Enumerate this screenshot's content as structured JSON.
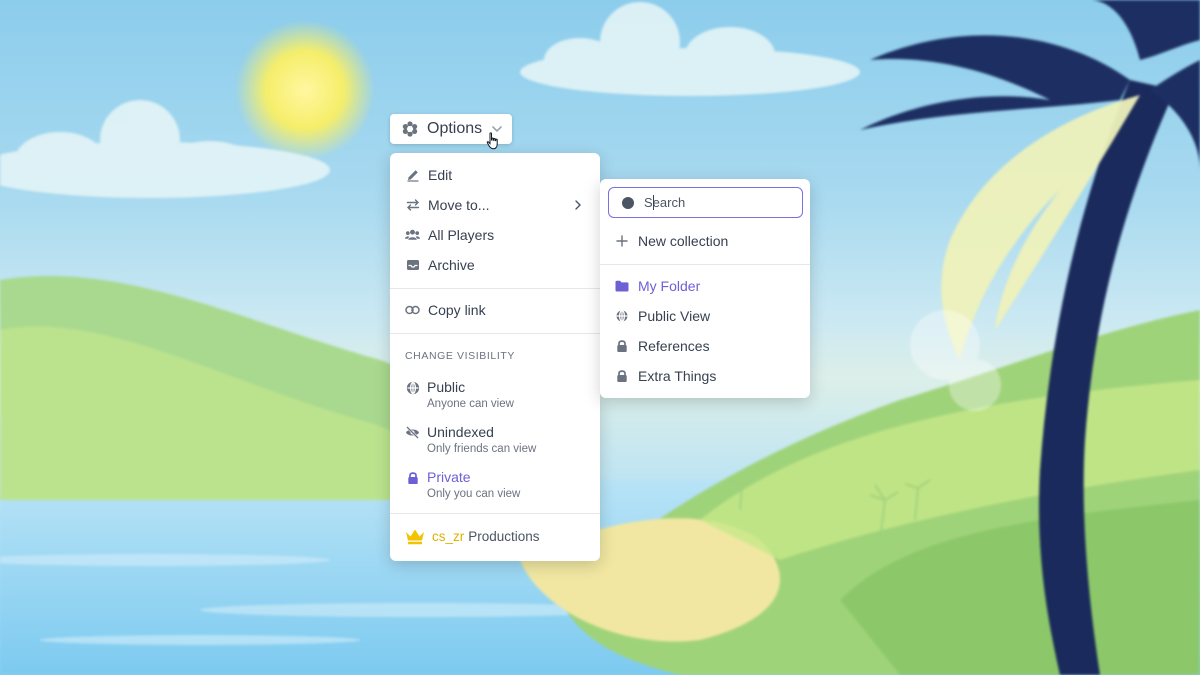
{
  "options_button": {
    "label": "Options"
  },
  "menu": {
    "items": [
      {
        "label": "Edit",
        "icon": "pencil-icon"
      },
      {
        "label": "Move to...",
        "icon": "arrows-exchange-icon",
        "has_submenu": true
      },
      {
        "label": "All Players",
        "icon": "users-icon"
      },
      {
        "label": "Archive",
        "icon": "inbox-icon"
      }
    ],
    "copy_link": {
      "label": "Copy link",
      "icon": "link-icon"
    },
    "visibility": {
      "heading": "CHANGE VISIBILITY",
      "options": [
        {
          "label": "Public",
          "description": "Anyone can view",
          "icon": "globe-icon"
        },
        {
          "label": "Unindexed",
          "description": "Only friends can view",
          "icon": "eye-off-icon"
        },
        {
          "label": "Private",
          "description": "Only you can view",
          "icon": "lock-icon",
          "selected": true
        }
      ]
    },
    "brand": {
      "user": "cs_zr",
      "suffix": "Productions",
      "icon": "crown-icon"
    }
  },
  "submenu": {
    "search": {
      "placeholder": "Search",
      "value": ""
    },
    "new_collection": {
      "label": "New collection",
      "icon": "plus-icon"
    },
    "folders": [
      {
        "label": "My Folder",
        "icon": "folder-icon",
        "active": true
      },
      {
        "label": "Public View",
        "icon": "globe-icon"
      },
      {
        "label": "References",
        "icon": "lock-icon"
      },
      {
        "label": "Extra Things",
        "icon": "lock-icon"
      }
    ]
  },
  "colors": {
    "accent": "#6d5fd6",
    "brand_gold": "#e0b100",
    "text": "#374151",
    "muted": "#6b7280"
  }
}
